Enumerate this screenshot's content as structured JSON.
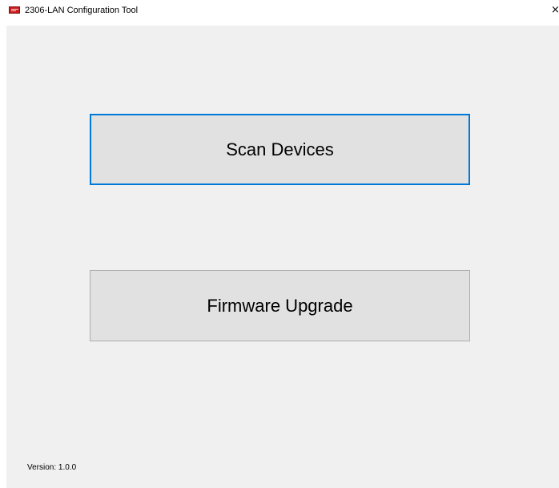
{
  "window": {
    "title": "2306-LAN Configuration Tool",
    "icon": "app-logo-icon",
    "close_glyph": "×"
  },
  "main": {
    "scan_button_label": "Scan Devices",
    "firmware_button_label": "Firmware Upgrade"
  },
  "footer": {
    "version_text": "Version: 1.0.0"
  },
  "colors": {
    "client_background": "#f0f0f0",
    "button_face": "#e1e1e1",
    "button_border": "#adadad",
    "focus_border": "#0078d7",
    "app_icon": "#c81e1e"
  }
}
